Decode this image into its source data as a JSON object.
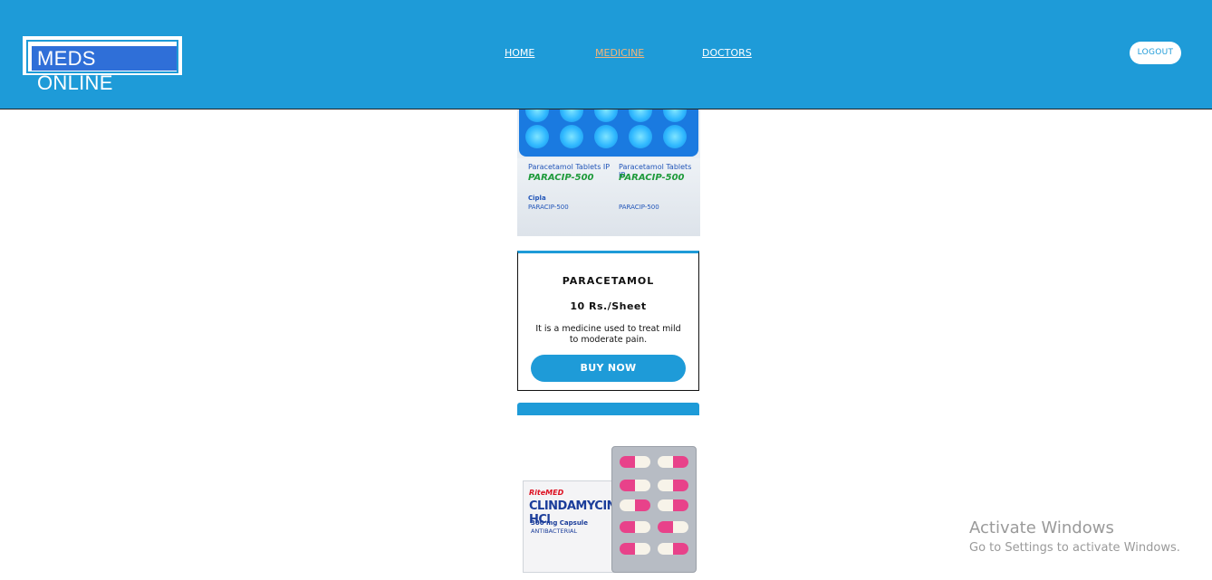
{
  "header": {
    "logo_text": "MEDS ONLINE",
    "nav": [
      {
        "label": "HOME",
        "active": false
      },
      {
        "label": "MEDICINE",
        "active": true
      },
      {
        "label": "DOCTORS",
        "active": false
      }
    ],
    "logout_label": "LOGOUT"
  },
  "product_images": {
    "paracetamol": {
      "strip_line1": "Paracetamol Tablets IP",
      "strip_line2": "PARACIP-500",
      "strip_brand": "Cipla"
    },
    "clindamycin": {
      "brand": "RiteMED",
      "name": "CLINDAMYCIN HCl",
      "dose": "300 mg Capsule",
      "category": "ANTIBACTERIAL"
    }
  },
  "products": [
    {
      "name": "PARACETAMOL",
      "price": "10 Rs./Sheet",
      "description": "It is a medicine used to treat mild to moderate pain.",
      "button_label": "BUY NOW"
    }
  ],
  "overlay": {
    "activate_title": "Activate Windows",
    "activate_sub": "Go to Settings to activate Windows."
  },
  "colors": {
    "header_bg": "#1e9bd8",
    "active_nav": "#f2b57a",
    "button_bg": "#1e9bd8"
  }
}
